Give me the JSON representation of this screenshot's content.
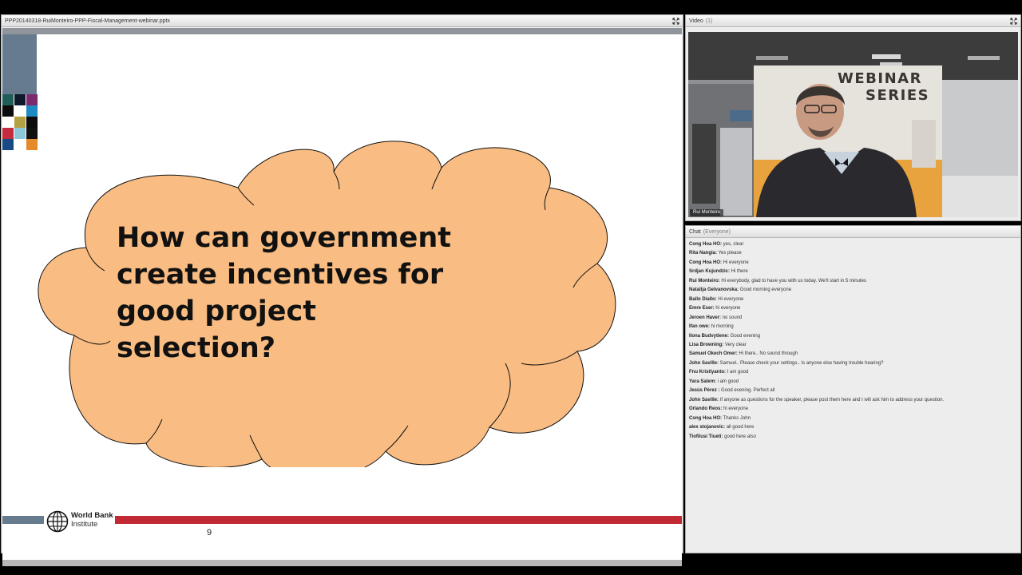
{
  "share_pod": {
    "title": "PPP20140318-RuiMonteiro-PPP-Fiscal-Management-webinar.pptx"
  },
  "slide": {
    "question": "How can government\ncreate incentives for\ngood project\nselection?",
    "page_number": "9",
    "logo_line1": "World Bank",
    "logo_line2": "Institute",
    "colors": {
      "cloud": "#f9bc82",
      "red_bar": "#c22a33",
      "blue_bar": "#667c8e"
    }
  },
  "video_pod": {
    "title": "Video",
    "count": "(1)",
    "presenter": "Rui Monteiro",
    "banner_line1": "WEBINAR",
    "banner_line2": "SERIES"
  },
  "chat_pod": {
    "title": "Chat",
    "scope": "(Everyone)",
    "messages": [
      {
        "name": "Cong Hoa HO:",
        "text": "yes, clear"
      },
      {
        "name": "Rita Nangia:",
        "text": "Yes please"
      },
      {
        "name": "Cong Hoa HO:",
        "text": "Hi everyone"
      },
      {
        "name": "Srdjan Kujundzic:",
        "text": "Hi there"
      },
      {
        "name": "Rui Monteiro:",
        "text": "Hi everybody, glad to have you with us today. We'll start in 5 minutes"
      },
      {
        "name": "Natalija Gelvanovska:",
        "text": "Good morning everyone"
      },
      {
        "name": "Bailo Diallo:",
        "text": "Hi everyone"
      },
      {
        "name": "Emre Eser:",
        "text": "hi everyone"
      },
      {
        "name": "Jeroen Haver:",
        "text": "no sound"
      },
      {
        "name": "Ifan owe:",
        "text": "hi morning"
      },
      {
        "name": "Ilona Budvytiene:",
        "text": "Good evening"
      },
      {
        "name": "Lisa Browning:",
        "text": "Very clear"
      },
      {
        "name": "Samuel Okech Omer:",
        "text": "Hi there.. No sound through"
      },
      {
        "name": "John Saville:",
        "text": "Samuel.. Please check your settings.. Is anyone else having trouble hearing?"
      },
      {
        "name": "Fnu Kristiyanto:",
        "text": "I am good"
      },
      {
        "name": "Yara Salem:",
        "text": "i am good"
      },
      {
        "name": "Jesús Pérez :",
        "text": "Good evening. Perfect all"
      },
      {
        "name": "John Saville:",
        "text": "If anyone as questions for the speaker, please post them here and I will ask him to address your question."
      },
      {
        "name": "Orlando Reos:",
        "text": "hi everyone"
      },
      {
        "name": "Cong Hoa HO:",
        "text": "Thanks John"
      },
      {
        "name": "alex stojanovic:",
        "text": "all good here"
      },
      {
        "name": "Tiofilusi Tiueti:",
        "text": "good here also"
      }
    ]
  }
}
